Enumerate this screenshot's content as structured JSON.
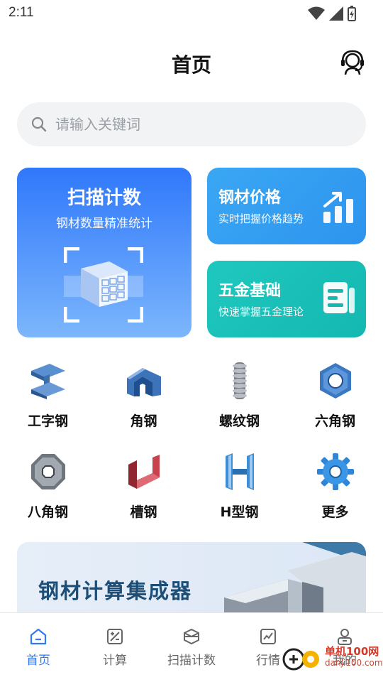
{
  "status_bar": {
    "time": "2:11"
  },
  "header": {
    "title": "首页"
  },
  "search": {
    "placeholder": "请输入关键词"
  },
  "cards": {
    "scan": {
      "title": "扫描计数",
      "subtitle": "钢材数量精准统计"
    },
    "price": {
      "title": "钢材价格",
      "subtitle": "实时把握价格趋势"
    },
    "hardware": {
      "title": "五金基础",
      "subtitle": "快速掌握五金理论"
    }
  },
  "grid": [
    {
      "label": "工字钢",
      "icon": "i-beam-icon"
    },
    {
      "label": "角钢",
      "icon": "angle-steel-icon"
    },
    {
      "label": "螺纹钢",
      "icon": "rebar-icon"
    },
    {
      "label": "六角钢",
      "icon": "hexagon-steel-icon"
    },
    {
      "label": "八角钢",
      "icon": "octagon-steel-icon"
    },
    {
      "label": "槽钢",
      "icon": "channel-steel-icon"
    },
    {
      "label": "H型钢",
      "icon": "h-beam-icon"
    },
    {
      "label": "更多",
      "icon": "gear-icon"
    }
  ],
  "banner": {
    "title": "钢材计算集成器"
  },
  "nav": [
    {
      "label": "首页",
      "icon": "home-icon",
      "active": true
    },
    {
      "label": "计算",
      "icon": "calculator-icon",
      "active": false
    },
    {
      "label": "扫描计数",
      "icon": "scan-icon",
      "active": false
    },
    {
      "label": "行情",
      "icon": "chart-icon",
      "active": false
    },
    {
      "label": "我的",
      "icon": "profile-icon",
      "active": false
    }
  ],
  "watermark": {
    "text": "单机100网",
    "sub": "danji100.com"
  },
  "colors": {
    "accent": "#2f78fb",
    "teal": "#14b8b0",
    "banner_text": "#1c4e78"
  }
}
